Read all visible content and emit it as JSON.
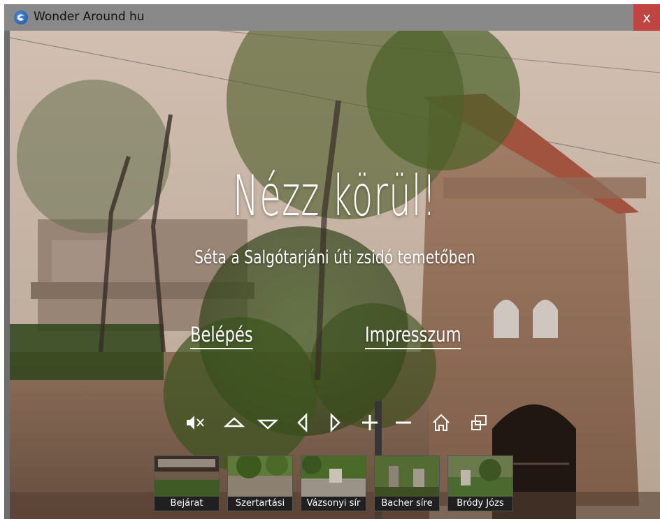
{
  "window": {
    "title": "Wonder Around hu",
    "close_label": "x"
  },
  "hero": {
    "headline": "Nézz körül!",
    "subtitle": "Séta a Salgótarjáni úti zsidó temetőben"
  },
  "nav": {
    "enter": "Belépés",
    "impressum": "Impresszum"
  },
  "controls": [
    {
      "name": "mute-icon"
    },
    {
      "name": "tilt-up-icon"
    },
    {
      "name": "tilt-down-icon"
    },
    {
      "name": "pan-left-icon"
    },
    {
      "name": "pan-right-icon"
    },
    {
      "name": "zoom-in-icon"
    },
    {
      "name": "zoom-out-icon"
    },
    {
      "name": "home-icon"
    },
    {
      "name": "fullscreen-icon"
    }
  ],
  "thumbnails": [
    {
      "label": "Bejárat"
    },
    {
      "label": "Szertartási"
    },
    {
      "label": "Vázsonyi sír"
    },
    {
      "label": "Bacher síre"
    },
    {
      "label": "Bródy Józs"
    }
  ]
}
